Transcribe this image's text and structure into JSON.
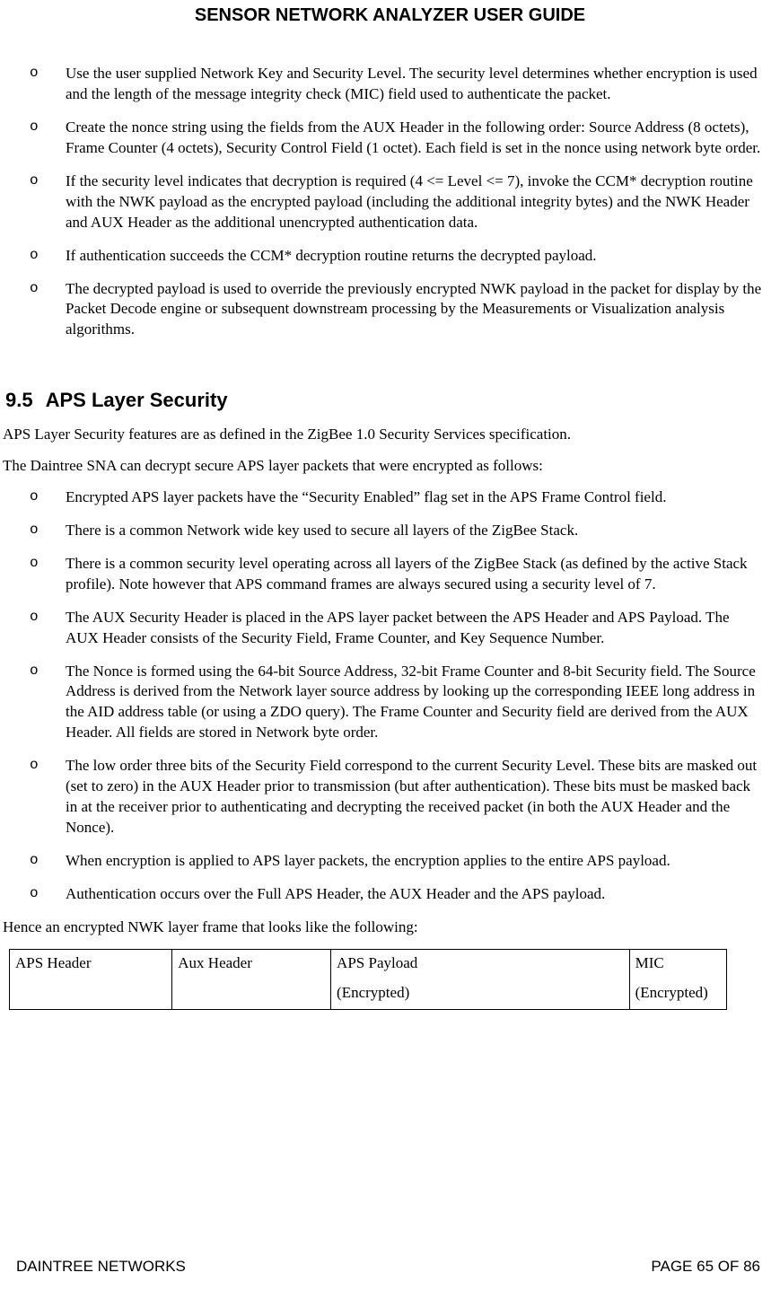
{
  "header": {
    "title": "SENSOR NETWORK ANALYZER USER GUIDE"
  },
  "list1": {
    "items": [
      "Use the user supplied Network Key and Security Level. The security level determines whether encryption is used and the length of the message integrity check (MIC) field used to authenticate the packet.",
      "Create the nonce string using the fields from the AUX Header in the following order: Source Address (8 octets), Frame Counter (4 octets), Security Control Field (1 octet). Each field is set in the nonce using network byte order.",
      "If the security level indicates that decryption is required (4 <= Level <= 7), invoke the CCM* decryption routine with the NWK payload as the encrypted payload (including the additional integrity bytes) and the NWK Header and AUX Header as the additional unencrypted authentication data.",
      "If authentication succeeds the CCM* decryption routine returns the decrypted payload.",
      "The decrypted payload is used to override the previously encrypted NWK payload in the packet for display by the Packet Decode engine or subsequent downstream processing by the Measurements or Visualization analysis algorithms."
    ]
  },
  "section": {
    "number": "9.5",
    "title": "APS Layer Security"
  },
  "paragraphs": {
    "p1": "APS Layer Security features are as defined in the ZigBee 1.0 Security Services specification.",
    "p2": "The Daintree SNA can decrypt secure APS layer packets that were encrypted as follows:"
  },
  "list2": {
    "items": [
      "Encrypted APS layer packets have the “Security Enabled” flag set in the APS Frame Control field.",
      "There is a common Network wide key used to secure all layers of the ZigBee Stack.",
      "There is a common security level operating across all layers of the ZigBee Stack (as defined by the active Stack profile). Note however that APS command frames are always secured using a security level of 7.",
      "The AUX Security Header is placed in the APS layer packet between the APS Header and APS Payload. The AUX Header consists of the Security Field, Frame Counter, and Key Sequence Number.",
      "The Nonce is formed using the 64-bit Source Address, 32-bit Frame Counter and 8-bit Security field. The Source Address is derived from the Network layer source address by looking up the corresponding IEEE long address in the AID address table (or using a ZDO query). The Frame Counter and Security field are derived from the AUX Header. All fields are stored in Network byte order.",
      "The low order three bits of the Security Field correspond to the current Security Level. These bits are masked out (set to zero) in the AUX Header prior to transmission (but after authentication). These bits must be masked back in at the receiver prior to authenticating and decrypting the received packet (in both the AUX Header and the Nonce).",
      "When encryption is applied to APS layer packets, the encryption applies to the entire APS payload.",
      "Authentication occurs over the Full APS Header, the AUX Header and the APS payload."
    ]
  },
  "table_intro": "Hence an encrypted NWK layer frame that looks like the following:",
  "table": {
    "cells": {
      "c1": "APS Header",
      "c2": "Aux Header",
      "c3a": "APS Payload",
      "c3b": "(Encrypted)",
      "c4a": "MIC",
      "c4b": "(Encrypted)"
    }
  },
  "footer": {
    "left": "DAINTREE NETWORKS",
    "right": "PAGE 65 OF 86"
  }
}
